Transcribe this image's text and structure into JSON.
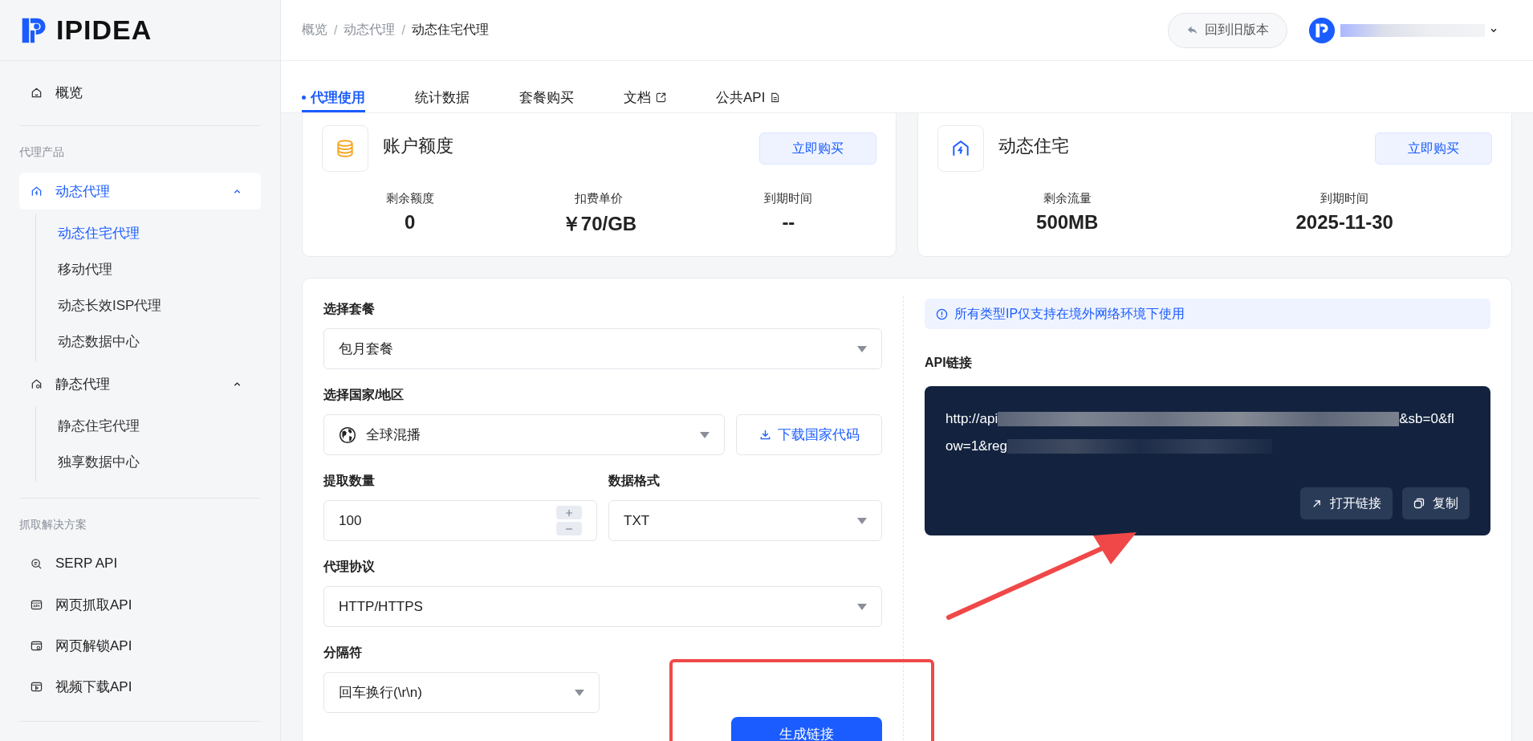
{
  "logo": {
    "text": "IPIDEA"
  },
  "sidebar": {
    "top_item": {
      "label": "概览",
      "selected": false
    },
    "sections": [
      {
        "title": "代理产品",
        "items": [
          {
            "label": "动态代理",
            "selected": true,
            "expanded": true,
            "children": [
              {
                "label": "动态住宅代理",
                "selected": true
              },
              {
                "label": "移动代理",
                "selected": false
              },
              {
                "label": "动态长效ISP代理",
                "selected": false
              },
              {
                "label": "动态数据中心",
                "selected": false
              }
            ]
          },
          {
            "label": "静态代理",
            "selected": false,
            "expanded": true,
            "children": [
              {
                "label": "静态住宅代理",
                "selected": false
              },
              {
                "label": "独享数据中心",
                "selected": false
              }
            ]
          }
        ]
      },
      {
        "title": "抓取解决方案",
        "items": [
          {
            "label": "SERP API",
            "selected": false
          },
          {
            "label": "网页抓取API",
            "selected": false
          },
          {
            "label": "网页解锁API",
            "selected": false
          },
          {
            "label": "视频下载API",
            "selected": false
          }
        ]
      }
    ]
  },
  "breadcrumb": [
    "概览",
    "动态代理",
    "动态住宅代理"
  ],
  "breadcrumb_separator": "/",
  "back_button": "回到旧版本",
  "tabs": [
    {
      "label": "代理使用",
      "selected": true,
      "kind": "plain"
    },
    {
      "label": "统计数据",
      "selected": false,
      "kind": "plain"
    },
    {
      "label": "套餐购买",
      "selected": false,
      "kind": "plain"
    },
    {
      "label": "文档",
      "selected": false,
      "kind": "external"
    },
    {
      "label": "公共API",
      "selected": false,
      "kind": "doc"
    }
  ],
  "cards": [
    {
      "title": "账户额度",
      "button": "立即购买",
      "stats": [
        {
          "label": "剩余额度",
          "value": "0"
        },
        {
          "label": "扣费单价",
          "value": "￥70/GB"
        },
        {
          "label": "到期时间",
          "value": "--"
        }
      ]
    },
    {
      "title": "动态住宅",
      "button": "立即购买",
      "stats": [
        {
          "label": "剩余流量",
          "value": "500MB"
        },
        {
          "label": "到期时间",
          "value": "2025-11-30"
        }
      ]
    }
  ],
  "form": {
    "package": {
      "label": "选择套餐",
      "value": "包月套餐"
    },
    "region": {
      "label": "选择国家/地区",
      "value": "全球混播",
      "download_button": "下载国家代码"
    },
    "quantity": {
      "label": "提取数量",
      "value": "100"
    },
    "format": {
      "label": "数据格式",
      "value": "TXT"
    },
    "protocol": {
      "label": "代理协议",
      "value": "HTTP/HTTPS"
    },
    "separator": {
      "label": "分隔符",
      "value": "回车换行(\\r\\n)"
    },
    "generate_button": "生成链接"
  },
  "api": {
    "notice": "所有类型IP仅支持在境外网络环境下使用",
    "label": "API链接",
    "url_line1_start": "http://api",
    "url_line1_end": "&sb=0&fl",
    "url_line2_start": "ow=1&reg",
    "buttons": [
      {
        "label": "打开链接",
        "kind": "open"
      },
      {
        "label": "复制",
        "kind": "copy"
      }
    ]
  }
}
